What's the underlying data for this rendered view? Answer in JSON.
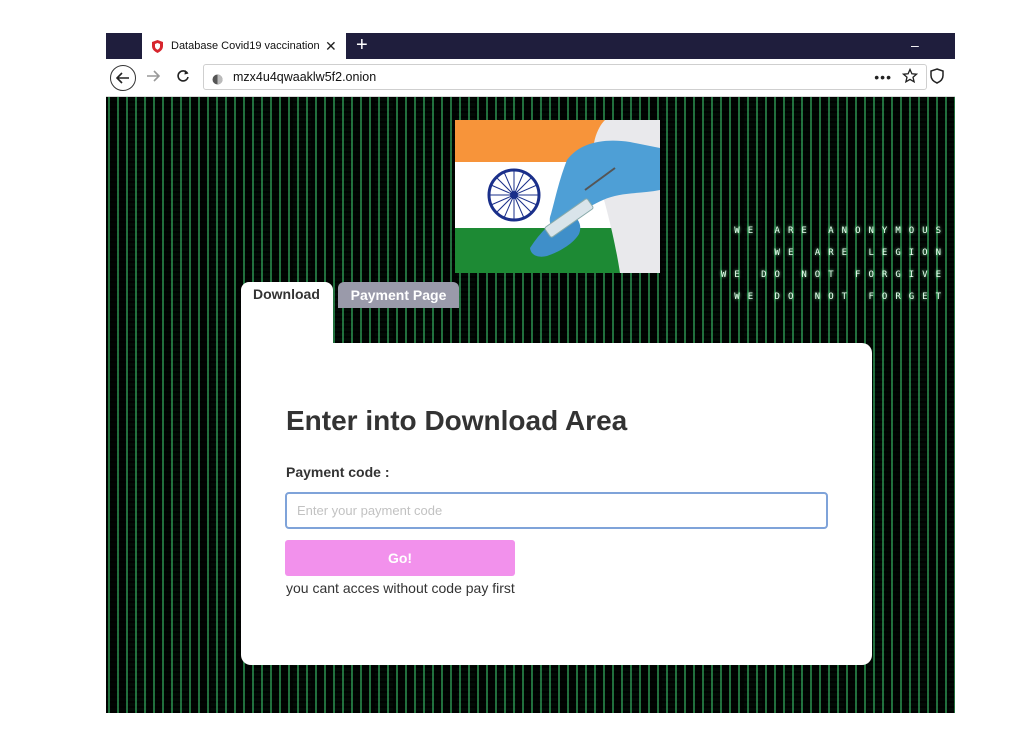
{
  "browser": {
    "tab_title": "Database Covid19 vaccination I",
    "new_tab_label": "+",
    "minimize_label": "–",
    "url": "mzx4u4qwaaklw5f2.onion",
    "more_label": "•••"
  },
  "background": {
    "matrix_lines": [
      "WE  ARE  ANONYMOUS",
      "WE  ARE  LEGION",
      "WE  DO  NOT  FORGIVE",
      "WE  DO  NOT  FORGET"
    ]
  },
  "tabs": {
    "download_label": "Download",
    "payment_label": "Payment Page"
  },
  "form": {
    "title": "Enter into Download Area",
    "payment_code_label": "Payment code :",
    "payment_code_placeholder": "Enter your payment code",
    "payment_code_value": "",
    "go_button_label": "Go!",
    "notice": "you cant acces without code pay first"
  },
  "colors": {
    "titlebar": "#1f1e3d",
    "go_button": "#f291ec",
    "payment_tab": "#9a9aaa",
    "input_border": "#7fa3d9",
    "flag_saffron": "#f7943a",
    "flag_green": "#1d8a34",
    "chakra": "#1a2f8a",
    "glove": "#4e9fd6"
  },
  "icons": {
    "favicon": "shield-icon",
    "back": "back-arrow-icon",
    "forward": "forward-arrow-icon",
    "reload": "reload-icon",
    "site_info": "site-info-icon",
    "star": "star-icon",
    "shield": "shield-icon"
  }
}
